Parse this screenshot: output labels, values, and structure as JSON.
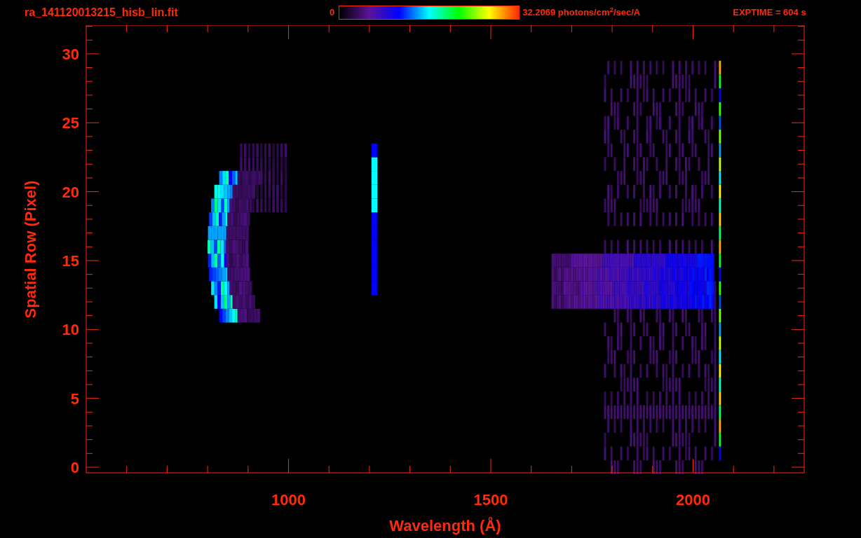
{
  "header": {
    "filename": "ra_141120013215_hisb_lin.fit",
    "colorbar": {
      "min": "0",
      "max": "32.2069 photons/cm$^{2}$/sec/A"
    },
    "exposure": "EXPTIME = 604 s"
  },
  "plot": {
    "ylabel": "Spatial Row (Pixel)",
    "xlabel": "Wavelength (Å)",
    "yticks": [
      "30",
      "25",
      "20",
      "15",
      "10",
      "5",
      "0"
    ],
    "xticks": [
      "1000",
      "1500",
      "2000"
    ]
  }
}
